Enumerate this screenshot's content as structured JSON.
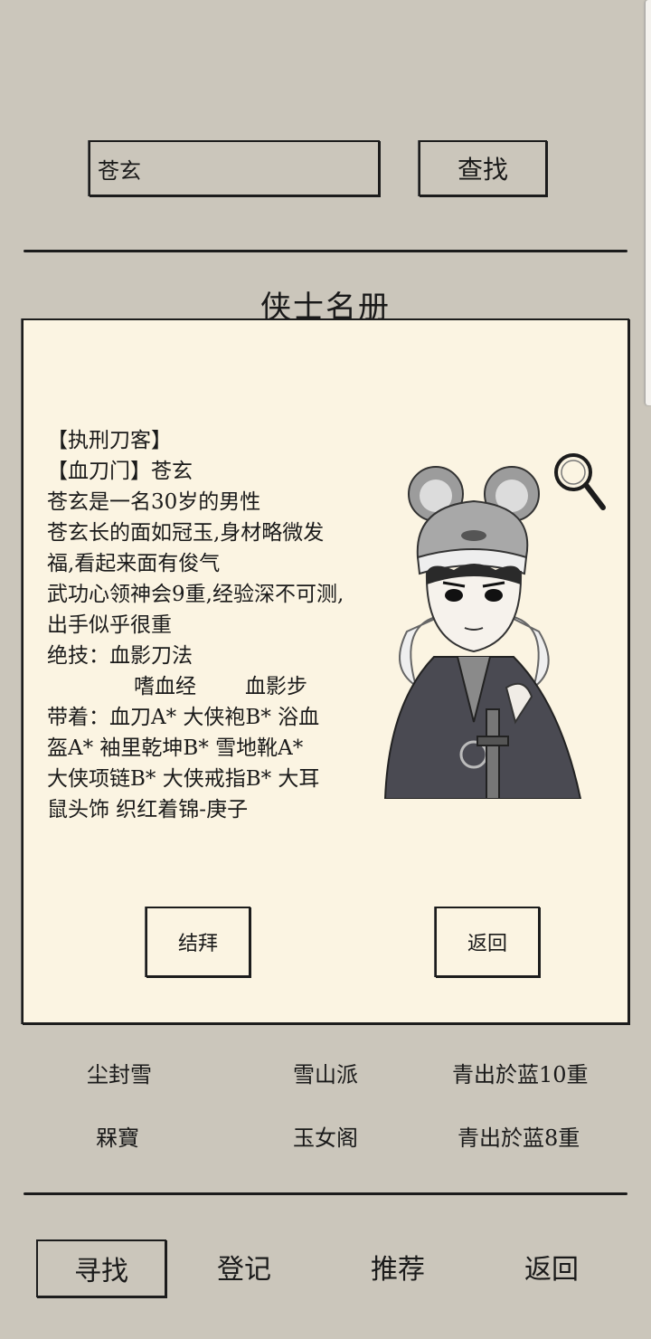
{
  "search": {
    "value": "苍玄",
    "button": "查找"
  },
  "title": "侠士名册",
  "profile": {
    "lines": [
      "【执刑刀客】",
      "【血刀门】苍玄",
      "苍玄是一名30岁的男性",
      "苍玄长的面如冠玉,身材略微发",
      "福,看起来面有俊气",
      "武功心领神会9重,经验深不可测,",
      "出手似乎很重",
      "绝技：血影刀法"
    ],
    "skills_extra": [
      "嗜血经",
      "血影步"
    ],
    "equip_lines": [
      "带着：血刀A*  大侠袍B*  浴血",
      "盔A*  袖里乾坤B*  雪地靴A*",
      "大侠项链B*  大侠戒指B*  大耳",
      "鼠头饰  织红着锦-庚子"
    ],
    "portrait_icon": "hero-portrait",
    "magnifier_icon": "magnifier-icon"
  },
  "card_buttons": {
    "sworn": "结拜",
    "back": "返回"
  },
  "list": [
    {
      "name": "尘封雪",
      "sect": "雪山派",
      "level": "青出於蓝10重"
    },
    {
      "name": "槑寶",
      "sect": "玉女阁",
      "level": "青出於蓝8重"
    }
  ],
  "nav": {
    "find": "寻找",
    "register": "登记",
    "recommend": "推荐",
    "back": "返回"
  }
}
